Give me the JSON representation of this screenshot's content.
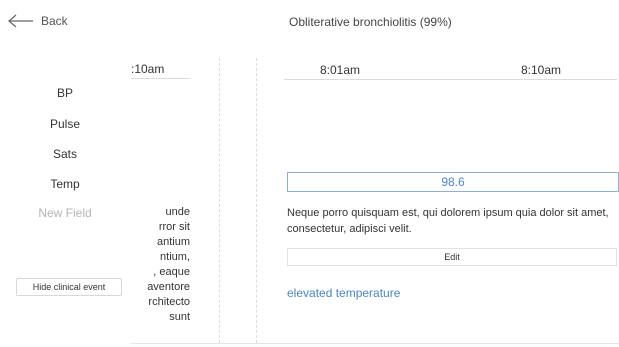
{
  "header": {
    "back_label": "Back",
    "title": "Obliterative bronchiolitis (99%)"
  },
  "sidebar": {
    "rows": [
      "BP",
      "Pulse",
      "Sats",
      "Temp"
    ],
    "new_field_label": "New Field",
    "hide_button_label": "Hide clinical event"
  },
  "partial_column": {
    "time": ":10am",
    "note_lines": [
      "unde",
      "rror sit",
      "antium",
      "ntium,",
      ", eaque",
      "aventore",
      "rchitecto",
      "sunt"
    ]
  },
  "main_column": {
    "times": [
      "8:01am",
      "8:10am"
    ],
    "temp_value": "98.6",
    "note": "Neque porro quisquam est, qui dolorem ipsum quia dolor sit amet, consectetur, adipisci velit.",
    "edit_label": "Edit",
    "event_label": "elevated temperature"
  },
  "colors": {
    "accent": "#4a86c8",
    "input_border": "#8ab0e0",
    "muted_text": "#b5b5b5"
  },
  "icons": {
    "back": "arrow-left-icon"
  }
}
